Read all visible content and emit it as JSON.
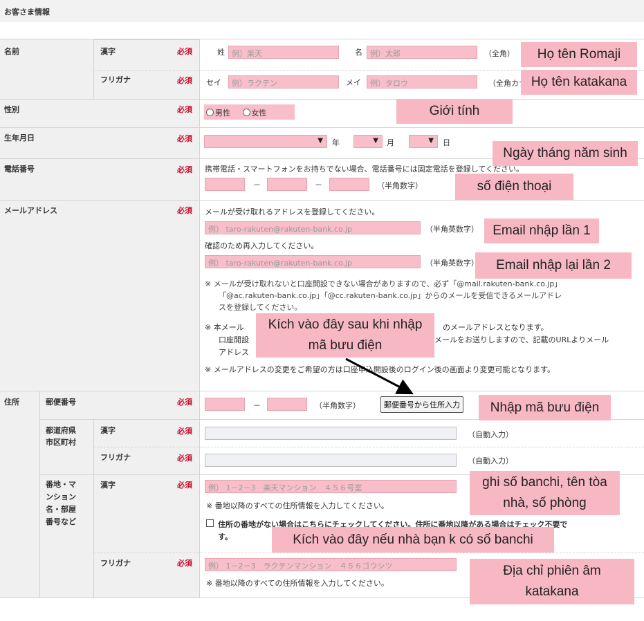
{
  "header": {
    "title": "お客さま情報"
  },
  "required": "必須",
  "name": {
    "label": "名前",
    "kanji": {
      "label": "漢字",
      "sei_label": "姓",
      "sei_placeholder": "例）楽天",
      "mei_label": "名",
      "mei_placeholder": "例）太郎",
      "note": "（全角）"
    },
    "furigana": {
      "label": "フリガナ",
      "sei_label": "セイ",
      "sei_placeholder": "例）ラクテン",
      "mei_label": "メイ",
      "mei_placeholder": "例）タロウ",
      "note": "（全角カナ）"
    }
  },
  "gender": {
    "label": "性別",
    "male": "男性",
    "female": "女性"
  },
  "birthday": {
    "label": "生年月日",
    "year": "年",
    "month": "月",
    "day": "日"
  },
  "phone": {
    "label": "電話番号",
    "instruction": "携帯電話・スマートフォンをお持ちでない場合、電話番号には固定電話を登録してください。",
    "dash": "－",
    "note": "（半角数字）"
  },
  "email": {
    "label": "メールアドレス",
    "instruction": "メールが受け取れるアドレスを登録してください。",
    "placeholder": "例） taro-rakuten@rakuten-bank.co.jp",
    "note": "（半角英数字）",
    "confirm_instruction": "確認のため再入力してください。",
    "notice1_line1": "※ メールが受け取れないと口座開設できない場合がありますので、必ず「@mail.rakuten-bank.co.jp」",
    "notice1_line2": "「@ac.rakuten-bank.co.jp」「@cc.rakuten-bank.co.jp」からのメールを受信できるメールアドレ",
    "notice1_line3": "スを登録してください。",
    "notice2_line1a": "※ 本メール",
    "notice2_line1b": "のメールアドレスとなります。",
    "notice2_line2a": "口座開設",
    "notice2_line2b": "メールをお送りしますので、記載のURLよりメール",
    "notice2_line3": "アドレス",
    "notice3": "※ メールアドレスの変更をご希望の方は口座申込開設後のログイン後の画面より変更可能となります。"
  },
  "address": {
    "label": "住所",
    "postal": {
      "label": "郵便番号",
      "dash": "－",
      "note": "（半角数字）",
      "button": "郵便番号から住所入力"
    },
    "prefecture": {
      "label_line1": "都道府県",
      "label_line2": "市区町村",
      "kanji_label": "漢字",
      "furigana_label": "フリガナ",
      "auto_note": "（自動入力）"
    },
    "street": {
      "label_lines": [
        "番地・マ",
        "ンション",
        "名・部屋",
        "番号など"
      ],
      "kanji_label": "漢字",
      "kanji_placeholder": "例） 1－2－3　楽天マンション　４５６号室",
      "note": "※ 番地以降のすべての住所情報を入力してください。",
      "checkbox_line1": "住所の番地がない場合はこちらにチェックしてください。住所に番地以降がある場合はチェック不要で",
      "checkbox_line2": "す。",
      "furigana_label": "フリガナ",
      "furigana_placeholder": "例） 1－2－3　ラクテンマンション　４５６ゴウシツ",
      "furigana_note": "※ 番地以降のすべての住所情報を入力してください。"
    }
  },
  "annotations": {
    "romaji": "Họ tên Romaji",
    "katakana": "Họ tên katakana",
    "gender": "Giới tính",
    "birthday": "Ngày tháng năm sinh",
    "phone": "số điện thoại",
    "email1": "Email nhập lần 1",
    "email2": "Email nhập lại lần 2",
    "click_after_postal_line1": "Kích vào đây sau khi nhập",
    "click_after_postal_line2": "mã bưu điện",
    "postal": "Nhập mã bưu điện",
    "banchi_line1": "ghi số banchi, tên tòa",
    "banchi_line2": "nhà, số phòng",
    "no_banchi": "Kích vào đây nếu nhà bạn k có số banchi",
    "katakana_addr_line1": "Địa chỉ phiên âm",
    "katakana_addr_line2": "katakana"
  },
  "colors": {
    "required": "#c8102e",
    "input_fill": "#f8bec9",
    "annotation_fill": "#f7b8c4",
    "label_bg": "#f0f0f0"
  }
}
